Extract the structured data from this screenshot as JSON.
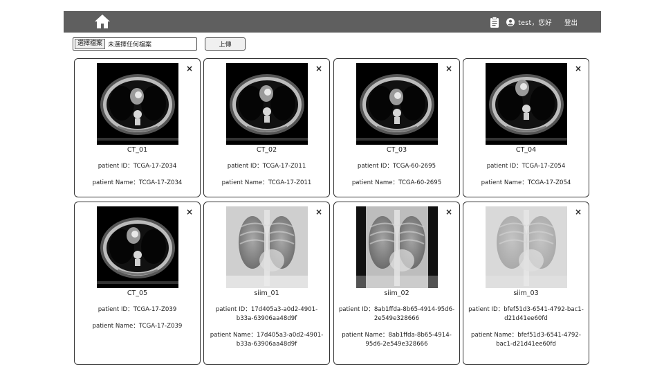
{
  "header": {
    "home_icon": "home-icon",
    "clipboard_icon": "clipboard-icon",
    "user_icon": "user-circle-icon",
    "user_label": "test，您好",
    "logout_label": "登出"
  },
  "upload": {
    "choose_label": "選擇檔案",
    "no_file_label": "未選擇任何檔案",
    "upload_label": "上傳"
  },
  "cards": [
    {
      "name": "CT_01",
      "patient_id": "patient ID：TCGA-17-Z034",
      "patient_name": "patient Name：TCGA-17-Z034",
      "kind": "ct",
      "close": "×"
    },
    {
      "name": "CT_02",
      "patient_id": "patient ID：TCGA-17-Z011",
      "patient_name": "patient Name：TCGA-17-Z011",
      "kind": "ct",
      "close": "×"
    },
    {
      "name": "CT_03",
      "patient_id": "patient ID：TCGA-60-2695",
      "patient_name": "patient Name：TCGA-60-2695",
      "kind": "ct",
      "close": "×"
    },
    {
      "name": "CT_04",
      "patient_id": "patient ID：TCGA-17-Z054",
      "patient_name": "patient Name：TCGA-17-Z054",
      "kind": "ct",
      "close": "×"
    },
    {
      "name": "CT_05",
      "patient_id": "patient ID：TCGA-17-Z039",
      "patient_name": "patient Name：TCGA-17-Z039",
      "kind": "ct",
      "close": "×"
    },
    {
      "name": "siim_01",
      "patient_id": "patient ID：17d405a3-a0d2-4901-b33a-63906aa48d9f",
      "patient_name": "patient Name：17d405a3-a0d2-4901-b33a-63906aa48d9f",
      "kind": "xray",
      "close": "×"
    },
    {
      "name": "siim_02",
      "patient_id": "patient ID：8ab1ffda-8b65-4914-95d6-2e549e328666",
      "patient_name": "patient Name：8ab1ffda-8b65-4914-95d6-2e549e328666",
      "kind": "xray",
      "close": "×"
    },
    {
      "name": "siim_03",
      "patient_id": "patient ID：bfef51d3-6541-4792-bac1-d21d41ee60fd",
      "patient_name": "patient Name：bfef51d3-6541-4792-bac1-d21d41ee60fd",
      "kind": "xray",
      "close": "×"
    }
  ]
}
